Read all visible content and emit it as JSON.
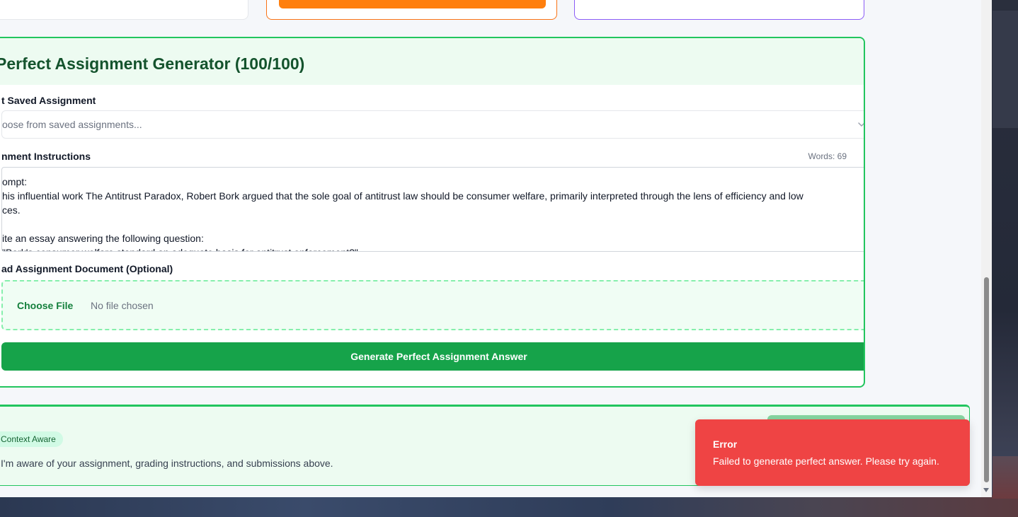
{
  "generator": {
    "title": "Perfect Assignment Generator (100/100)",
    "saved_label": "t Saved Assignment",
    "saved_placeholder": "oose from saved assignments...",
    "instructions_label": "nment Instructions",
    "word_count": "Words: 69",
    "instructions_text": "ompt:\nhis influential work The Antitrust Paradox, Robert Bork argued that the sole goal of antitrust law should be consumer welfare, primarily interpreted through the lens of efficiency and low\nces.\n\nite an essay answering the following question:\n\"Bork's consumer welfare standard an adequate basis for antitrust enforcement?\"",
    "upload_label": "ad Assignment Document (Optional)",
    "choose_file": "Choose File",
    "no_file": "No file chosen",
    "generate_button": "Generate Perfect Assignment Answer"
  },
  "chat": {
    "badge": "Context Aware",
    "message": "I'm aware of your assignment, grading instructions, and submissions above."
  },
  "toast": {
    "title": "Error",
    "message": "Failed to generate perfect answer. Please try again."
  },
  "colors": {
    "primary_green": "#16a34a",
    "panel_border": "#22c55e",
    "error_red": "#ef4444",
    "orange_accent": "#ff7f0e",
    "purple_accent": "#8b5cf6"
  },
  "icons": {
    "select_chevron": "chevron-down-icon",
    "textarea_resize": "resize-grip-icon"
  }
}
